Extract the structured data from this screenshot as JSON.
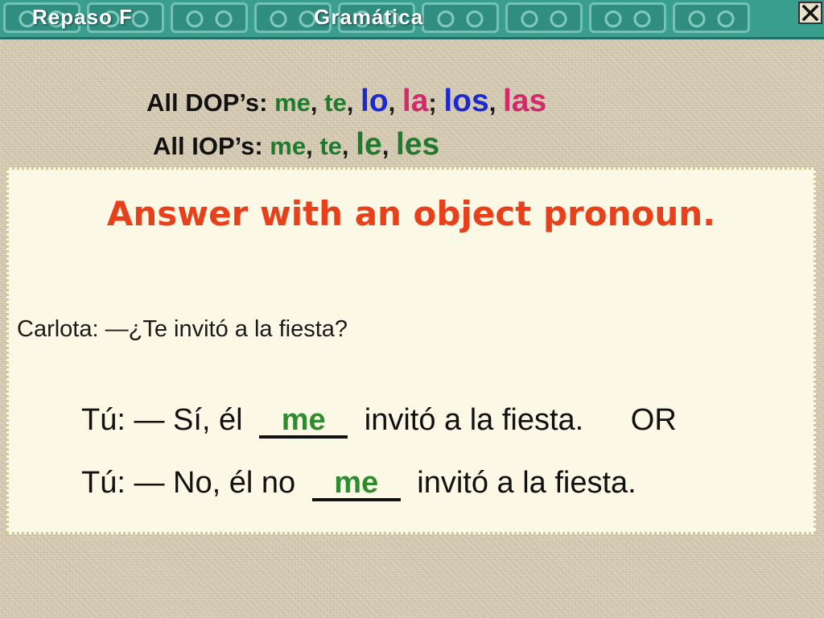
{
  "banner": {
    "left_title": "Repaso F",
    "right_title": "Gramática",
    "close_icon": "close-x-icon"
  },
  "dop": {
    "label": "All DOP’s:",
    "items": [
      "me",
      "te",
      "lo",
      "la",
      "los",
      "las"
    ],
    "separators": [
      ",",
      ",",
      ",",
      ";",
      ","
    ]
  },
  "iop": {
    "label": "All IOP’s:",
    "items": [
      "me",
      "te",
      "le",
      "les"
    ],
    "separators": [
      ",",
      ",",
      ","
    ]
  },
  "panel": {
    "heading": "Answer with an object pronoun.",
    "question": "Carlota: —¿Te invitó a la fiesta?",
    "answer1": {
      "prefix": "Tú: — Sí, él",
      "blank": "me",
      "suffix": "invitó a la fiesta.",
      "or": "OR"
    },
    "answer2": {
      "prefix": "Tú: — No, él no",
      "blank": "me",
      "suffix": "invitó a la fiesta."
    }
  },
  "colors": {
    "banner": "#3a9e8f",
    "heading": "#e8401a",
    "green": "#1f7a2e",
    "blue": "#1a2ad0",
    "pink": "#d12a6a"
  }
}
